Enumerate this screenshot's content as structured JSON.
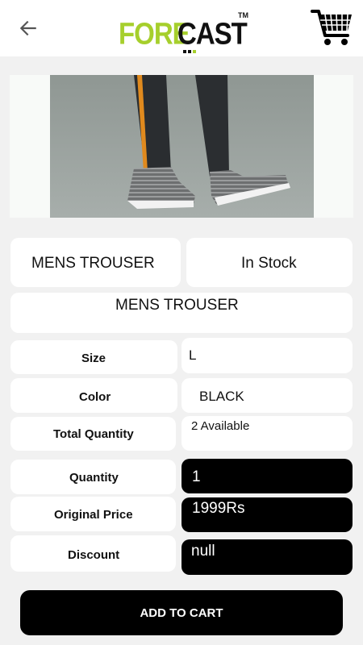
{
  "header": {
    "logo_part1": "FORE",
    "logo_part2": "CAST",
    "logo_tm": "TM",
    "logo_dot_colors": [
      "#111111",
      "#111111",
      "#a6cf2c"
    ]
  },
  "icons": {
    "back": "arrow-left-icon",
    "cart": "shopping-cart-icon"
  },
  "product": {
    "name": "MENS TROUSER",
    "stock_status": "In Stock",
    "description": "MENS TROUSER",
    "specs": [
      {
        "label": "Size",
        "value": "L"
      },
      {
        "label": "Color",
        "value": "BLACK"
      },
      {
        "label": "Total Quantity",
        "value": "2 Available"
      }
    ],
    "order": [
      {
        "label": "Quantity",
        "value": "1"
      },
      {
        "label": "Original Price",
        "value": "1999Rs"
      },
      {
        "label": "Discount",
        "value": "null"
      }
    ]
  },
  "actions": {
    "add_to_cart": "ADD TO CART"
  },
  "colors": {
    "brand_green": "#a6cf2c",
    "button_bg": "#000000",
    "page_bg": "#f1f1f1"
  }
}
